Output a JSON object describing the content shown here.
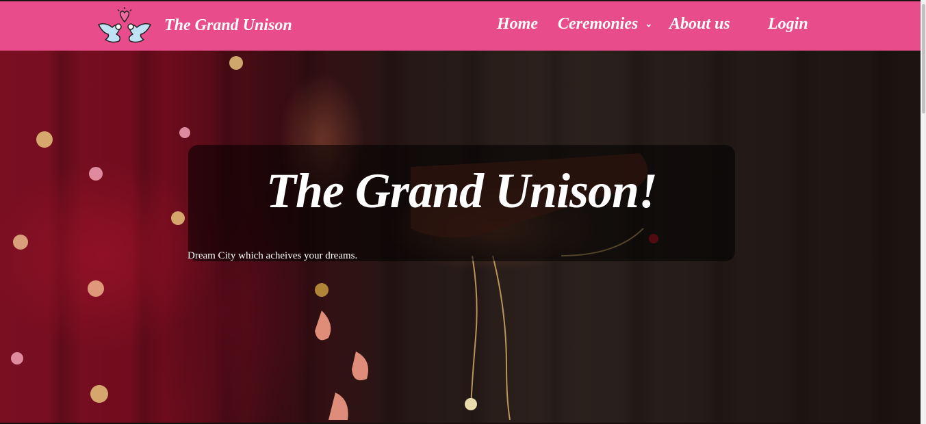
{
  "nav": {
    "brand": "The Grand Unison",
    "links": [
      {
        "label": "Home"
      },
      {
        "label": "Ceremonies",
        "dropdown": true
      },
      {
        "label": "About us"
      },
      {
        "label": "Login"
      }
    ],
    "background_color": "#e84c8a",
    "logo_icon": "doves-heart-icon",
    "dropdown_icon": "chevron-down-icon"
  },
  "hero": {
    "title": "The Grand Unison!",
    "subtitle": "Dream City which acheives your dreams."
  }
}
